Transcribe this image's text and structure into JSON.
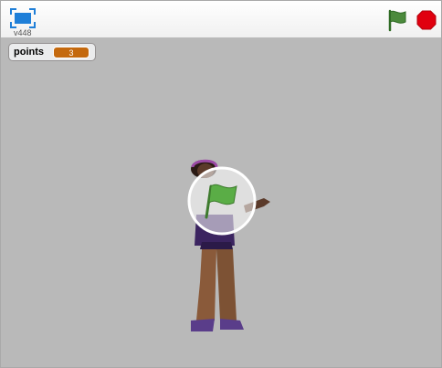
{
  "player": {
    "version": "v448",
    "fullscreen_icon": "fullscreen-icon",
    "green_flag_icon": "green-flag-icon",
    "stop_icon": "stop-sign-icon"
  },
  "stage": {
    "background": "#b9b9b9",
    "variable_monitor": {
      "label": "points",
      "value": "3",
      "value_color": "#c4690e"
    },
    "sprite": "character-sprite",
    "overlay_icon": "play-flag-overlay-icon"
  },
  "colors": {
    "flag_green": "#4b8a3c",
    "stop_red": "#e0000f",
    "fullscreen_blue": "#1f7fd8"
  }
}
